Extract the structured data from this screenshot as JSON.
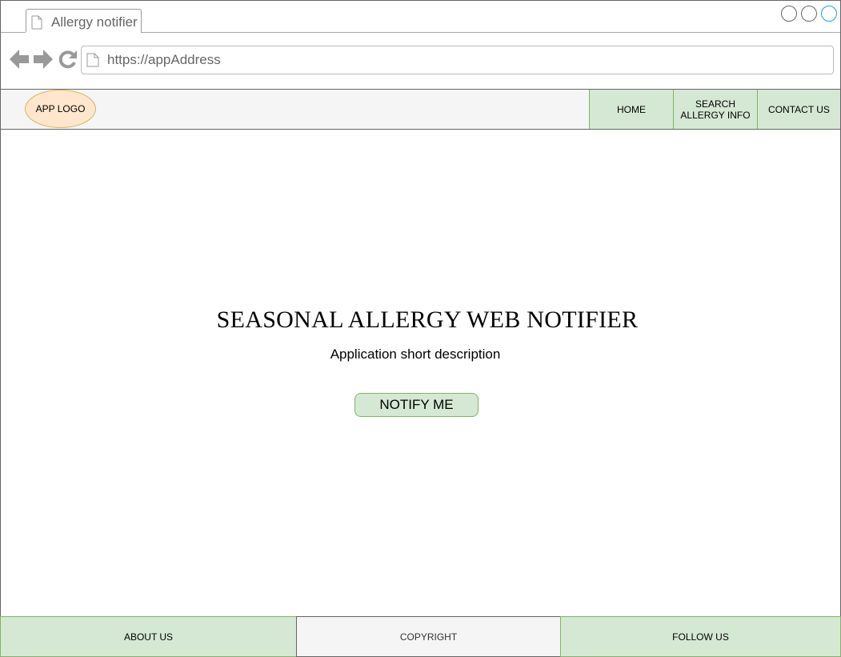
{
  "browser": {
    "tab_title": "Allergy notifier",
    "url": "https://appAddress"
  },
  "header": {
    "logo": "APP LOGO",
    "nav": [
      {
        "label": "HOME"
      },
      {
        "label": "SEARCH\nALLERGY INFO"
      },
      {
        "label": "CONTACT US"
      }
    ]
  },
  "main": {
    "title": "SEASONAL ALLERGY WEB NOTIFIER",
    "description": "Application short description",
    "cta": "NOTIFY ME"
  },
  "footer": {
    "about": "ABOUT US",
    "copyright": "COPYRIGHT",
    "follow": "FOLLOW US"
  },
  "colors": {
    "green_fill": "#d5e8d4",
    "green_border": "#82b366",
    "logo_fill": "#ffe6cc",
    "logo_border": "#d6b656",
    "header_bg": "#f5f5f5"
  }
}
